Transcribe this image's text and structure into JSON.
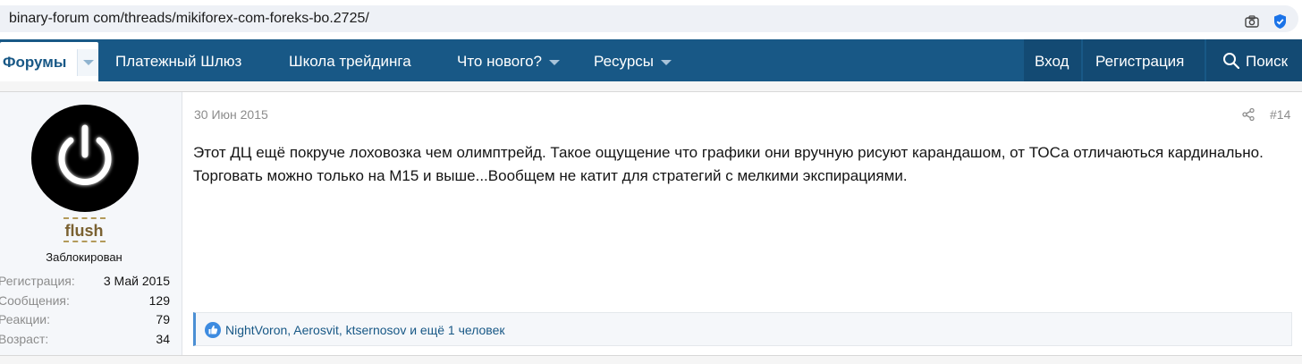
{
  "browser": {
    "url": "binary-forum com/threads/mikiforex-com-foreks-bo.2725/"
  },
  "nav": {
    "forums": "Форумы",
    "items": [
      "Платежный Шлюз",
      "Школа трейдинга",
      "Что нового?",
      "Ресурсы"
    ],
    "login": "Вход",
    "register": "Регистрация",
    "search": "Поиск"
  },
  "user": {
    "name": "flush",
    "status": "Заблокирован",
    "stats": [
      {
        "label": "Регистрация:",
        "value": "3 Май 2015"
      },
      {
        "label": "Сообщения:",
        "value": "129"
      },
      {
        "label": "Реакции:",
        "value": "79"
      },
      {
        "label": "Возраст:",
        "value": "34"
      }
    ]
  },
  "post": {
    "date": "30 Июн 2015",
    "number": "#14",
    "body": "Этот ДЦ ещё покруче лоховозка чем олимптрейд. Такое ощущение что графики они вручную рисуют карандашом, от ТОСа отличаються кардинально. Торговать можно только на М15 и выше...Вообщем не катит для стратегий с мелкими экспирациями.",
    "reactions": {
      "users": "NightVoron, Aerosvit, ktsernosov",
      "more": " и ещё 1 человек"
    }
  },
  "colors": {
    "nav_bg": "#185886",
    "nav_dark": "#134a73",
    "username": "#7a6131",
    "accent": "#4b8fd4"
  }
}
